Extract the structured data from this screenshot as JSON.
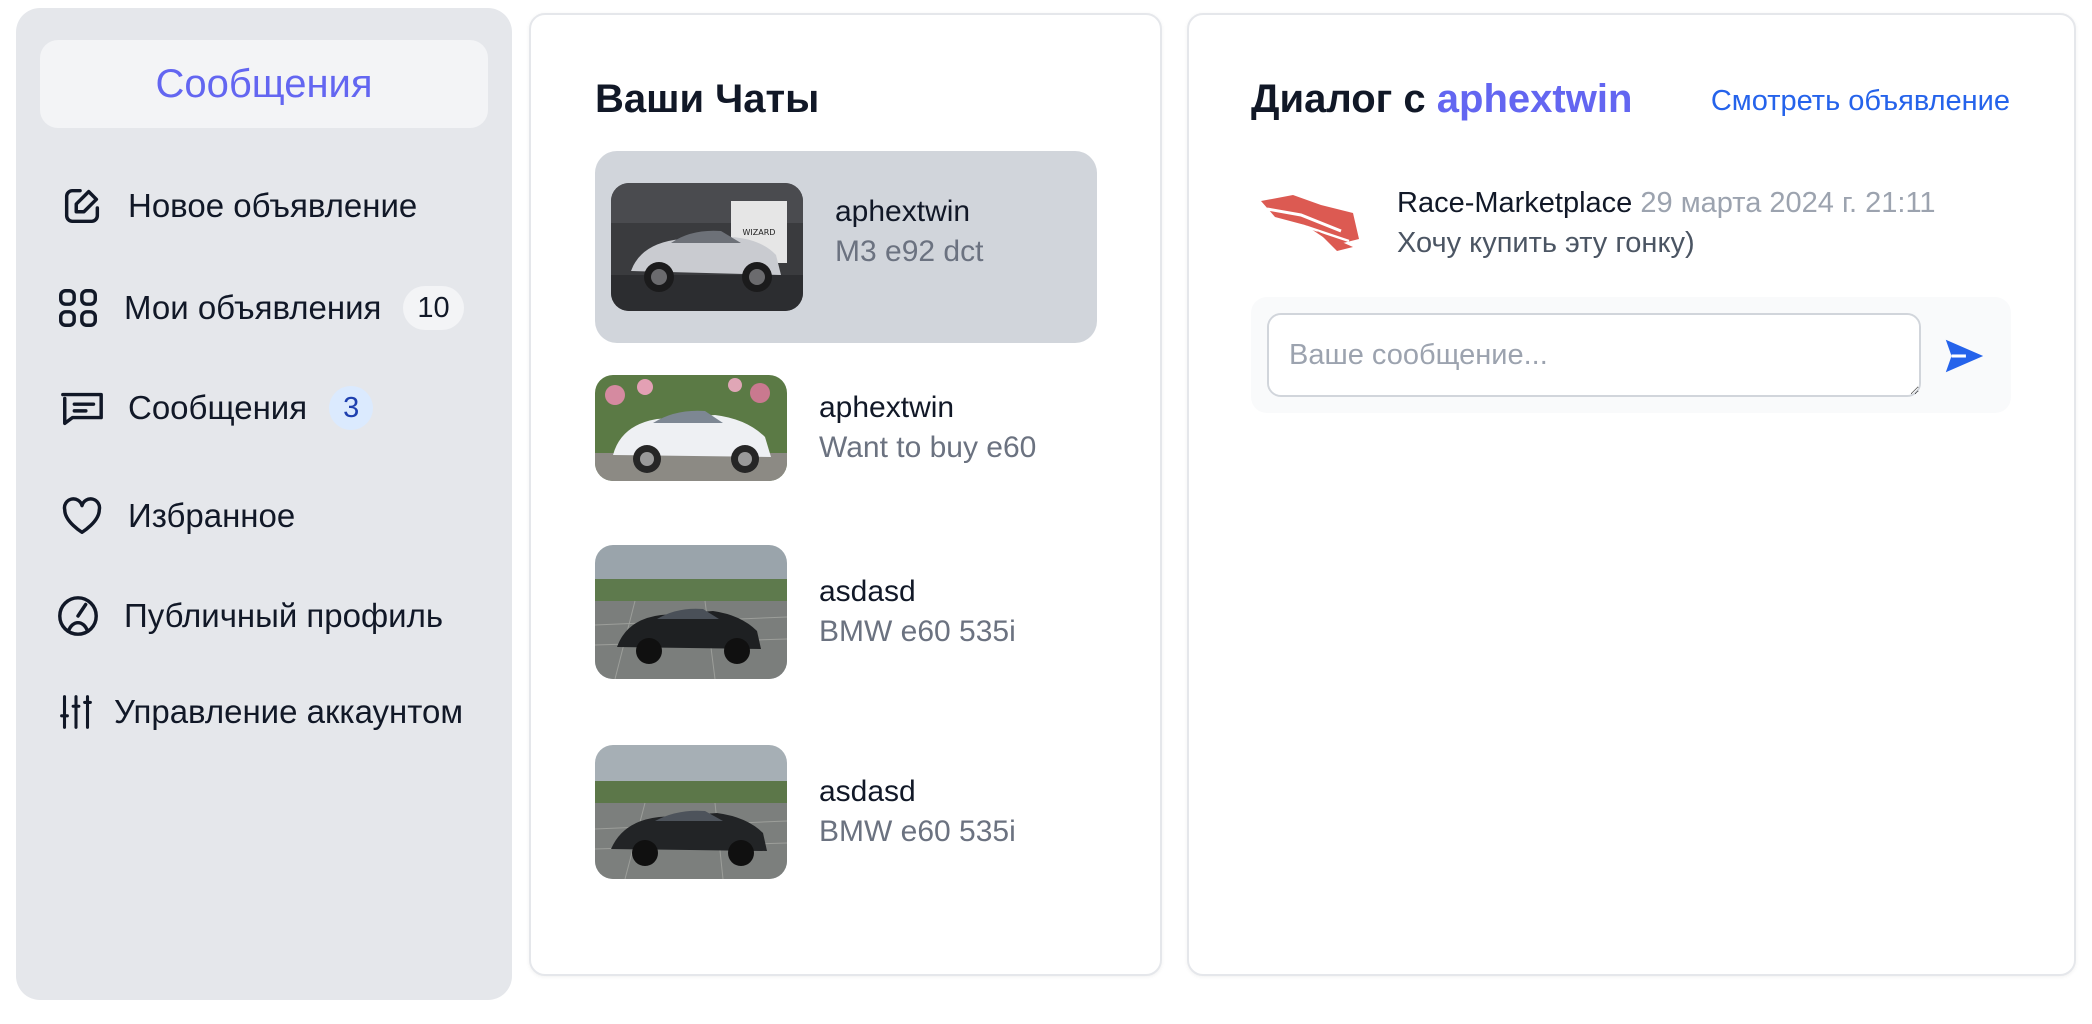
{
  "sidebar": {
    "header": "Сообщения",
    "items": [
      {
        "label": "Новое объявление",
        "icon": "edit-square-icon"
      },
      {
        "label": "Мои объявления",
        "icon": "grid-icon",
        "badge": "10"
      },
      {
        "label": "Сообщения",
        "icon": "message-icon",
        "badge": "3"
      },
      {
        "label": "Избранное",
        "icon": "heart-icon"
      },
      {
        "label": "Публичный профиль",
        "icon": "profile-icon"
      },
      {
        "label": "Управление аккаунтом",
        "icon": "sliders-icon"
      }
    ]
  },
  "chats": {
    "title": "Ваши Чаты",
    "items": [
      {
        "name": "aphextwin",
        "subtitle": "M3 e92 dct",
        "active": true
      },
      {
        "name": "aphextwin",
        "subtitle": "Want to buy e60",
        "active": false
      },
      {
        "name": "asdasd",
        "subtitle": "BMW e60 535i",
        "active": false
      },
      {
        "name": "asdasd",
        "subtitle": "BMW e60 535i",
        "active": false
      }
    ]
  },
  "dialog": {
    "title_prefix": "Диалог с",
    "username": "aphextwin",
    "view_listing": "Смотреть объявление",
    "messages": [
      {
        "sender": "Race-Marketplace",
        "time": "29 марта 2024 г. 21:11",
        "text": "Хочу купить эту гонку)"
      }
    ],
    "input_placeholder": "Ваше сообщение...",
    "send_icon": "send-icon"
  },
  "colors": {
    "accent": "#6366f1",
    "link": "#2563eb",
    "sidebar_bg": "#e5e7eb",
    "active_chat_bg": "#d1d5db",
    "logo_red": "#dc5a52"
  }
}
